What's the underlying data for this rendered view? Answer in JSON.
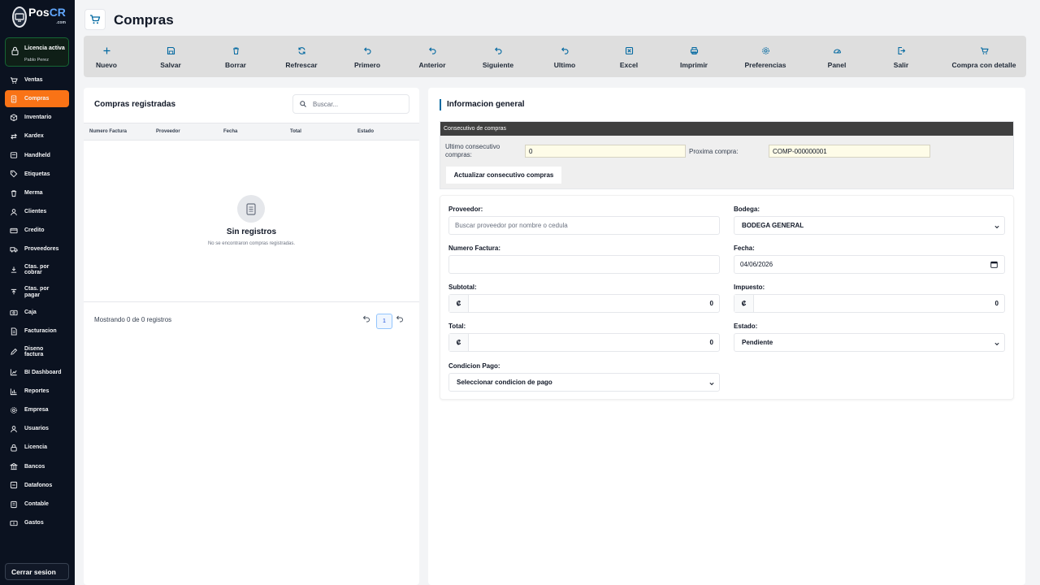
{
  "brand": {
    "name_a": "Pos",
    "name_b": "CR",
    "sub": ".com"
  },
  "license": {
    "title": "Licencia activa",
    "user": "Pablo Perez"
  },
  "nav": [
    {
      "label": "Ventas",
      "icon": "cart-icon"
    },
    {
      "label": "Compras",
      "icon": "doc-icon",
      "active": true
    },
    {
      "label": "Inventario",
      "icon": "box-icon"
    },
    {
      "label": "Kardex",
      "icon": "swap-icon"
    },
    {
      "label": "Handheld",
      "icon": "device-icon"
    },
    {
      "label": "Etiquetas",
      "icon": "tag-icon"
    },
    {
      "label": "Merma",
      "icon": "trash-icon"
    },
    {
      "label": "Clientes",
      "icon": "user-icon"
    },
    {
      "label": "Credito",
      "icon": "card-icon"
    },
    {
      "label": "Proveedores",
      "icon": "truck-icon"
    },
    {
      "label": "Ctas. por cobrar",
      "icon": "download-icon"
    },
    {
      "label": "Ctas. por pagar",
      "icon": "upload-icon"
    },
    {
      "label": "Caja",
      "icon": "cash-icon"
    },
    {
      "label": "Facturacion",
      "icon": "invoice-icon"
    },
    {
      "label": "Diseno factura",
      "icon": "pen-icon"
    },
    {
      "label": "BI Dashboard",
      "icon": "chart-icon"
    },
    {
      "label": "Reportes",
      "icon": "report-icon"
    },
    {
      "label": "Empresa",
      "icon": "gear-icon"
    },
    {
      "label": "Usuarios",
      "icon": "user-icon"
    },
    {
      "label": "Licencia",
      "icon": "lock-icon"
    },
    {
      "label": "Bancos",
      "icon": "bank-icon"
    },
    {
      "label": "Datafonos",
      "icon": "terminal-icon"
    },
    {
      "label": "Contable",
      "icon": "ledger-icon"
    },
    {
      "label": "Gastos",
      "icon": "money-icon"
    }
  ],
  "logout": "Cerrar sesion",
  "page": {
    "title": "Compras"
  },
  "toolbar": [
    {
      "label": "Nuevo",
      "icon": "plus-icon"
    },
    {
      "label": "Salvar",
      "icon": "save-icon"
    },
    {
      "label": "Borrar",
      "icon": "trash-icon"
    },
    {
      "label": "Refrescar",
      "icon": "refresh-icon"
    },
    {
      "label": "Primero",
      "icon": "undo-icon"
    },
    {
      "label": "Anterior",
      "icon": "undo-icon"
    },
    {
      "label": "Siguiente",
      "icon": "undo-icon"
    },
    {
      "label": "Ultimo",
      "icon": "undo-icon"
    },
    {
      "label": "Excel",
      "icon": "excel-icon"
    },
    {
      "label": "Imprimir",
      "icon": "print-icon"
    },
    {
      "label": "Preferencias",
      "icon": "gear-icon"
    },
    {
      "label": "Panel",
      "icon": "gauge-icon"
    },
    {
      "label": "Salir",
      "icon": "exit-icon"
    },
    {
      "label": "Compra con detalle",
      "icon": "cart-icon"
    }
  ],
  "list": {
    "title": "Compras registradas",
    "search_placeholder": "Buscar...",
    "columns": [
      "Numero Factura",
      "Proveedor",
      "Fecha",
      "Total",
      "Estado"
    ],
    "empty_title": "Sin registros",
    "empty_sub": "No se encontraron compras registradas.",
    "showing": "Mostrando 0 de 0 registros",
    "page": "1"
  },
  "info": {
    "title": "Informacion general",
    "consec_header": "Consecutivo de compras",
    "last_label": "Ultimo consecutivo compras:",
    "last_value": "0",
    "next_label": "Proxima compra:",
    "next_value": "COMP-000000001",
    "update_btn": "Actualizar consecutivo compras"
  },
  "form": {
    "proveedor_label": "Proveedor:",
    "proveedor_placeholder": "Buscar proveedor por nombre o cedula",
    "bodega_label": "Bodega:",
    "bodega_value": "BODEGA GENERAL",
    "factura_label": "Numero Factura:",
    "factura_value": "",
    "fecha_label": "Fecha:",
    "fecha_value": "04/06/2026",
    "subtotal_label": "Subtotal:",
    "subtotal_value": "0",
    "impuesto_label": "Impuesto:",
    "impuesto_value": "0",
    "total_label": "Total:",
    "total_value": "0",
    "estado_label": "Estado:",
    "estado_value": "Pendiente",
    "condicion_label": "Condicion Pago:",
    "condicion_value": "Seleccionar condicion de pago",
    "currency": "₡"
  },
  "colors": {
    "sidebar": "#0b1220",
    "active": "#f97316",
    "accent": "#0369a1"
  }
}
